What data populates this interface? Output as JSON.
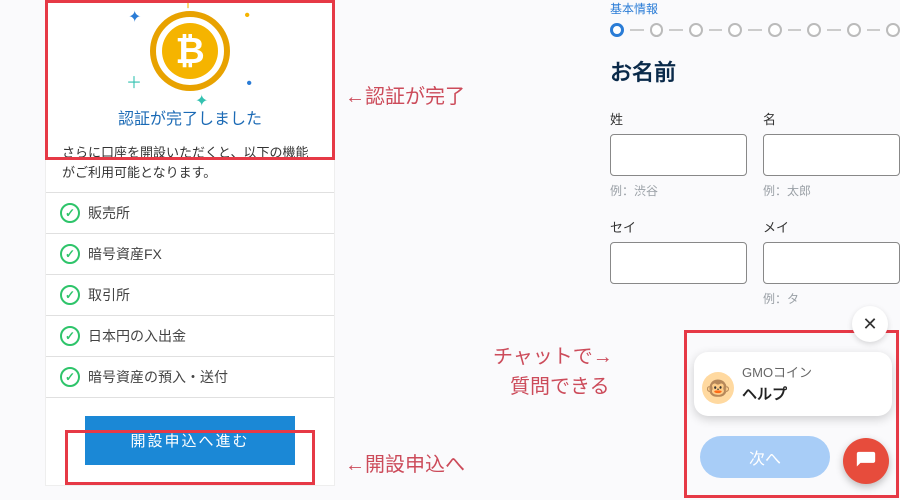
{
  "left": {
    "auth_complete": "認証が完了しました",
    "sub_desc": "さらに口座を開設いただくと、以下の機能がご利用可能となります。",
    "features": [
      "販売所",
      "暗号資産FX",
      "取引所",
      "日本円の入出金",
      "暗号資産の預入・送付"
    ],
    "apply_label": "開設申込へ進む"
  },
  "annotations": {
    "auth_done": "←認証が完了",
    "apply": "←開設申込へ",
    "chat1": "チャットで→",
    "chat2": "質問できる"
  },
  "form": {
    "section": "基本情報",
    "title": "お名前",
    "fields": {
      "sei": {
        "label": "姓",
        "hint": "例：渋谷"
      },
      "mei": {
        "label": "名",
        "hint": "例：太郎"
      },
      "sei_kana": {
        "label": "セイ",
        "hint": ""
      },
      "mei_kana": {
        "label": "メイ",
        "hint": "例：タ"
      }
    },
    "next": "次へ"
  },
  "chat": {
    "title": "GMOコイン",
    "message": "ヘルプ"
  },
  "icons": {
    "bitcoin_glyph": "₿",
    "check": "✓",
    "close": "✕",
    "monkey": "🐵"
  },
  "colors": {
    "highlight": "#e63946",
    "primary_blue": "#1b88d6",
    "text_red": "#cc4b5a",
    "launcher": "#e74c3c"
  }
}
